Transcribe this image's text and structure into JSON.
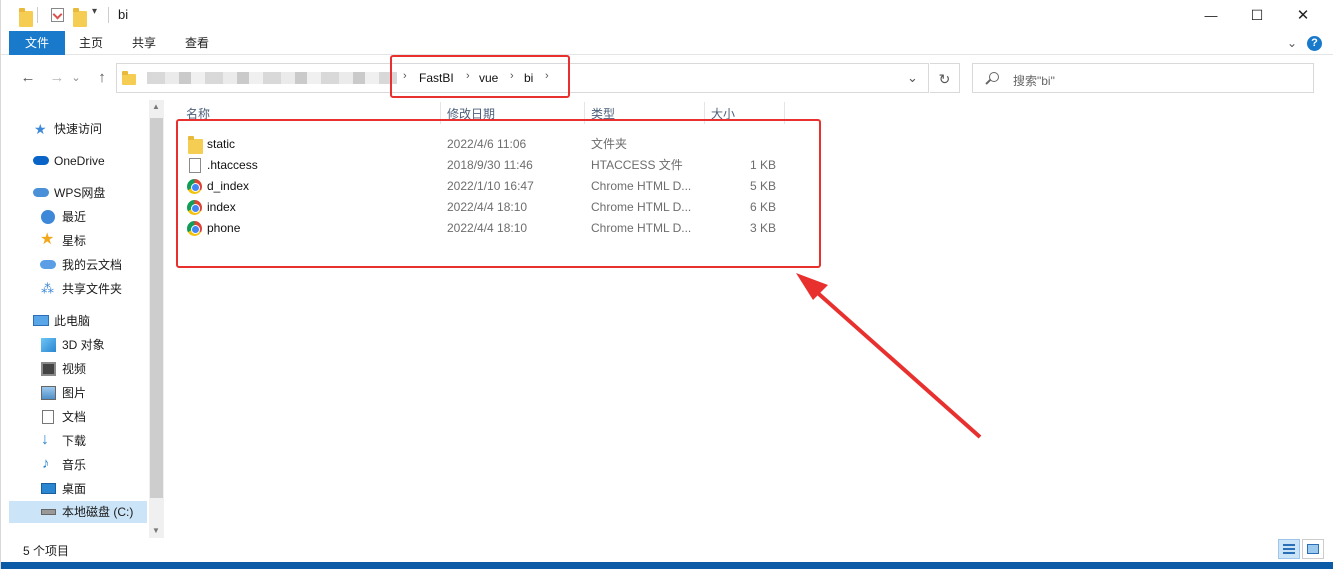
{
  "window": {
    "title": "bi",
    "minimize_glyph": "—",
    "maximize_glyph": "☐",
    "close_glyph": "✕"
  },
  "ribbon": {
    "tabs": [
      {
        "label": "文件"
      },
      {
        "label": "主页"
      },
      {
        "label": "共享"
      },
      {
        "label": "查看"
      }
    ],
    "expand_glyph": "⌄",
    "help_glyph": "?"
  },
  "navigation": {
    "back_glyph": "←",
    "forward_glyph": "→",
    "recent_glyph": "⌄",
    "up_glyph": "↑"
  },
  "address": {
    "breadcrumbs": [
      "FastBI",
      "vue",
      "bi"
    ],
    "separator": "›",
    "dropdown_glyph": "⌄",
    "refresh_glyph": "↻"
  },
  "search": {
    "placeholder": "搜索\"bi\""
  },
  "sidebar": {
    "items": [
      {
        "label": "快速访问",
        "icon": "star-pin-icon"
      },
      {
        "label": "OneDrive",
        "icon": "cloud-icon"
      },
      {
        "label": "WPS网盘",
        "icon": "cloud-icon"
      },
      {
        "label": "最近",
        "icon": "clock-icon"
      },
      {
        "label": "星标",
        "icon": "star-icon"
      },
      {
        "label": "我的云文档",
        "icon": "cloud-icon"
      },
      {
        "label": "共享文件夹",
        "icon": "share-icon"
      },
      {
        "label": "此电脑",
        "icon": "computer-icon"
      },
      {
        "label": "3D 对象",
        "icon": "cube-icon"
      },
      {
        "label": "视频",
        "icon": "video-icon"
      },
      {
        "label": "图片",
        "icon": "picture-icon"
      },
      {
        "label": "文档",
        "icon": "document-icon"
      },
      {
        "label": "下载",
        "icon": "download-icon"
      },
      {
        "label": "音乐",
        "icon": "music-icon"
      },
      {
        "label": "桌面",
        "icon": "desktop-icon"
      },
      {
        "label": "本地磁盘 (C:)",
        "icon": "drive-icon"
      }
    ]
  },
  "filelist": {
    "columns": [
      "名称",
      "修改日期",
      "类型",
      "大小"
    ],
    "rows": [
      {
        "name": "static",
        "date": "2022/4/6 11:06",
        "type": "文件夹",
        "size": "",
        "icon": "folder-icon"
      },
      {
        "name": ".htaccess",
        "date": "2018/9/30 11:46",
        "type": "HTACCESS 文件",
        "size": "1 KB",
        "icon": "file-icon"
      },
      {
        "name": "d_index",
        "date": "2022/1/10 16:47",
        "type": "Chrome HTML D...",
        "size": "5 KB",
        "icon": "chrome-icon"
      },
      {
        "name": "index",
        "date": "2022/4/4 18:10",
        "type": "Chrome HTML D...",
        "size": "6 KB",
        "icon": "chrome-icon"
      },
      {
        "name": "phone",
        "date": "2022/4/4 18:10",
        "type": "Chrome HTML D...",
        "size": "3 KB",
        "icon": "chrome-icon"
      }
    ]
  },
  "status": {
    "item_count": "5 个项目"
  },
  "colors": {
    "accent": "#1979ca",
    "annotation": "#e8312f",
    "selection": "#cce4f7"
  }
}
